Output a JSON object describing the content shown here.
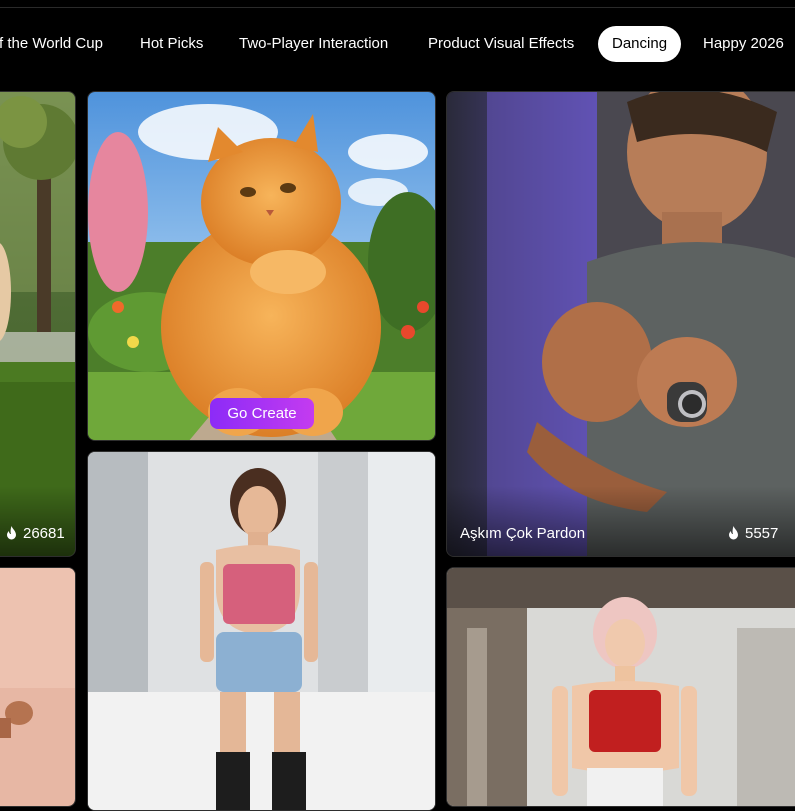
{
  "tabs": [
    {
      "label": "f the World Cup"
    },
    {
      "label": "Hot Picks"
    },
    {
      "label": "Two-Player Interaction"
    },
    {
      "label": "Product Visual Effects"
    },
    {
      "label": "Dancing",
      "active": true
    },
    {
      "label": "Happy 2026"
    }
  ],
  "cards": {
    "park_girl": {
      "count": "26681"
    },
    "cat": {
      "cta": "Go Create"
    },
    "man": {
      "title": "Aşkım Çok Pardon",
      "count": "5557"
    }
  },
  "colors": {
    "background": "#000000",
    "active_tab_bg": "#ffffff",
    "cta_gradient_start": "#8c2bf7",
    "cta_gradient_end": "#c43bf0"
  },
  "icons": {
    "count_icon": "flame-icon"
  }
}
